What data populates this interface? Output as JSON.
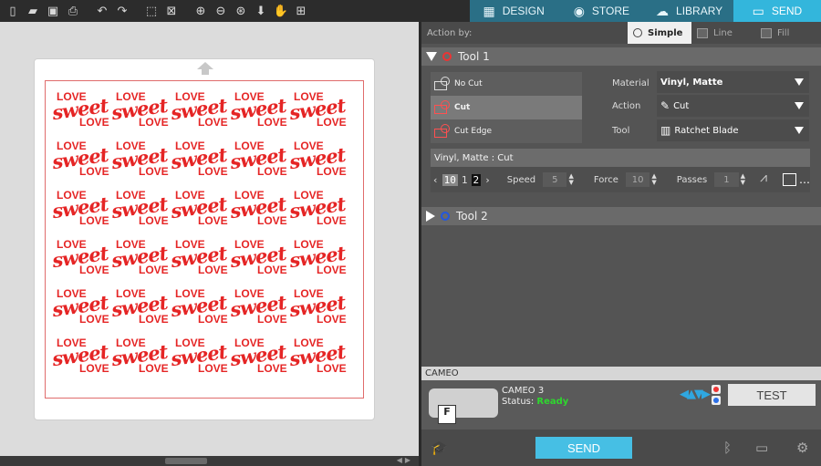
{
  "toolbar": {
    "icons": [
      "new-file-icon",
      "open-folder-icon",
      "save-icon",
      "print-icon",
      "undo-icon",
      "redo-icon",
      "select-all-icon",
      "deselect-icon",
      "zoom-in-icon",
      "zoom-out-icon",
      "zoom-fit-icon",
      "move-down-icon",
      "pan-hand-icon",
      "add-page-icon"
    ]
  },
  "nav": {
    "tabs": [
      {
        "label": "DESIGN",
        "icon": "grid-icon",
        "active": false
      },
      {
        "label": "STORE",
        "icon": "store-icon",
        "active": false
      },
      {
        "label": "LIBRARY",
        "icon": "cloud-icon",
        "active": false
      },
      {
        "label": "SEND",
        "icon": "cutter-icon",
        "active": true
      }
    ]
  },
  "design": {
    "line1": "LOVE",
    "line2": "sweet",
    "line3": "LOVE",
    "rows": 6,
    "cols": 5,
    "color": "#e52525"
  },
  "action": {
    "label": "Action by:",
    "modes": [
      {
        "label": "Simple",
        "active": true
      },
      {
        "label": "Line",
        "active": false
      },
      {
        "label": "Fill",
        "active": false
      }
    ]
  },
  "tool1": {
    "label": "Tool 1",
    "cut_options": [
      "No Cut",
      "Cut",
      "Cut Edge"
    ],
    "selected_option": "Cut",
    "material_label": "Material",
    "material_value": "Vinyl, Matte",
    "action_label": "Action",
    "action_value": "Cut",
    "tool_label": "Tool",
    "tool_value": "Ratchet Blade",
    "summary": "Vinyl, Matte : Cut",
    "blade_depth_a": "10",
    "blade_depth_b": "1",
    "blade_depth_c": "2",
    "speed_label": "Speed",
    "speed_value": "5",
    "force_label": "Force",
    "force_value": "10",
    "passes_label": "Passes",
    "passes_value": "1"
  },
  "tool2": {
    "label": "Tool 2"
  },
  "device": {
    "section": "CAMEO",
    "name": "CAMEO 3",
    "status_label": "Status:",
    "status_value": "Ready",
    "badge": "F",
    "test_label": "TEST"
  },
  "footer": {
    "send_label": "SEND"
  }
}
